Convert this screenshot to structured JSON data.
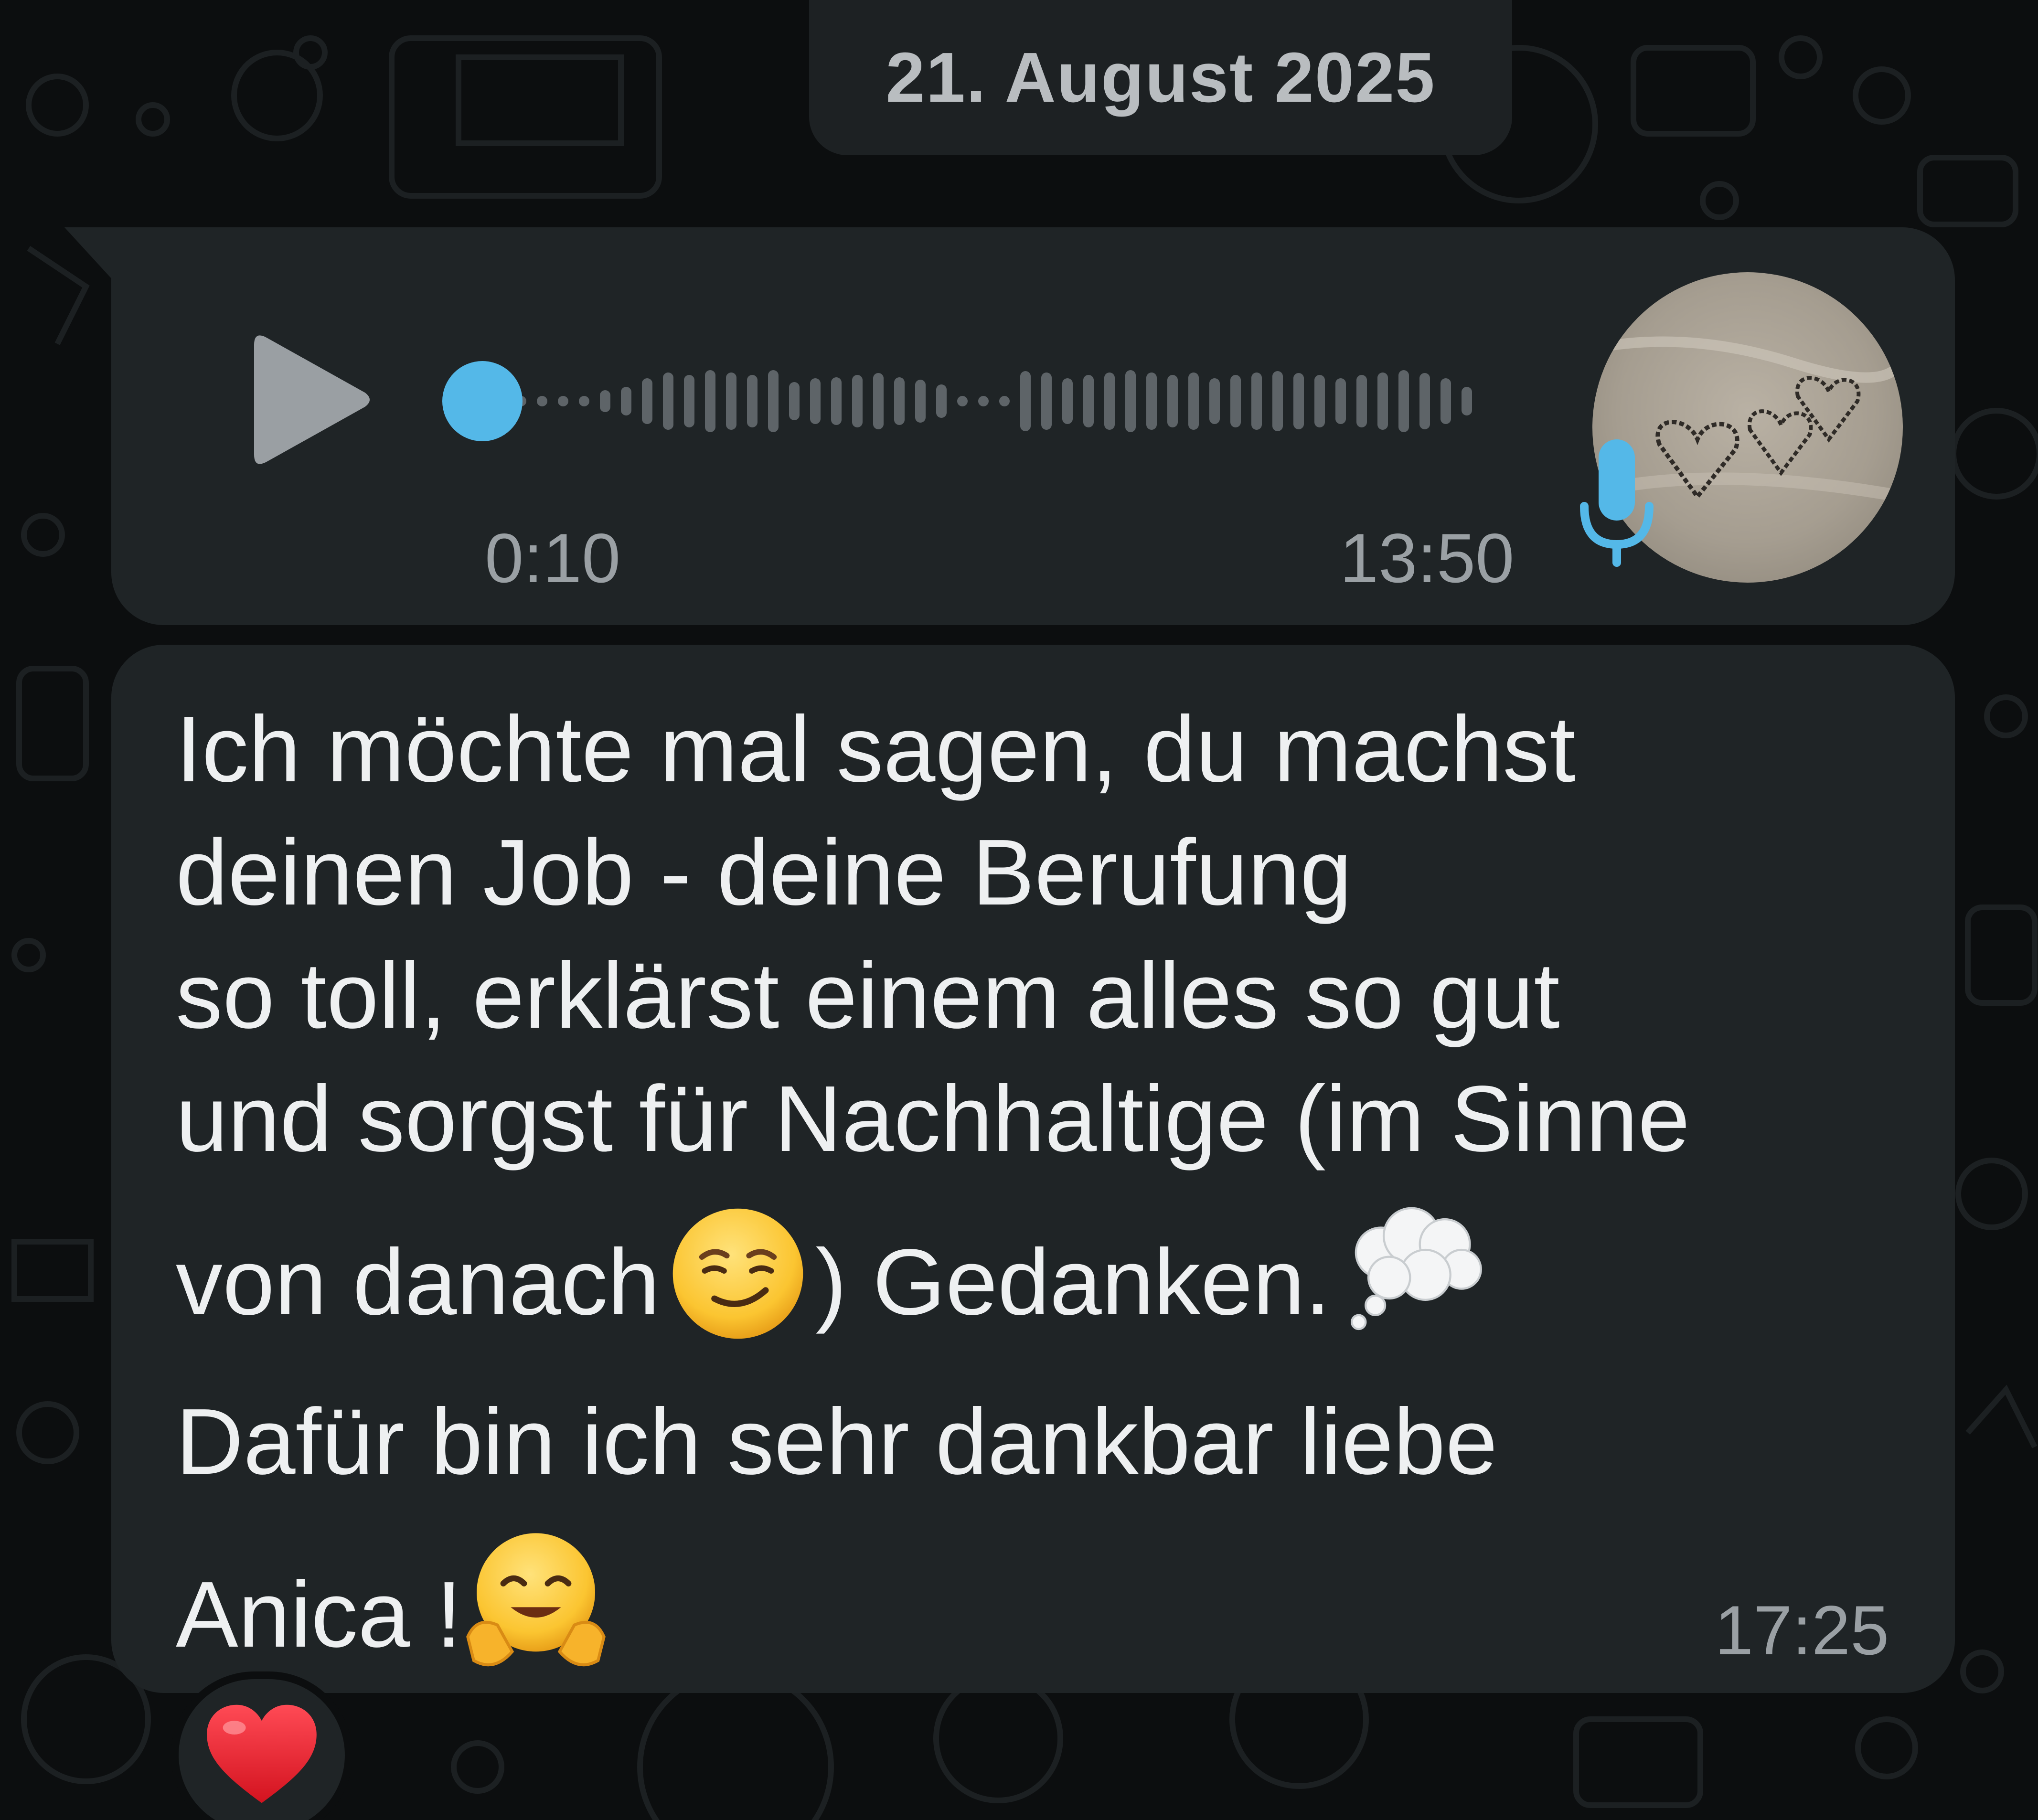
{
  "date_separator": "21. August 2025",
  "voice_message": {
    "duration": "0:10",
    "time": "13:50",
    "progress": 0,
    "play_icon": "play-icon",
    "mic_icon": "microphone-icon",
    "accent_color": "#54b8e8"
  },
  "text_message": {
    "lines": [
      "Ich möchte mal sagen, du machst",
      "deinen Job - deine Berufung",
      "so toll, erklärst einem alles so gut",
      "und sorgst für Nachhaltige (im Sinne"
    ],
    "line5_a": "von danach",
    "line5_b": ")  Gedanken.",
    "line6": "Dafür bin ich sehr dankbar liebe",
    "line7": "Anica !",
    "time": "17:25",
    "emojis": [
      "smirking-face",
      "thought-balloon",
      "hugging-face"
    ]
  },
  "reaction": {
    "emoji": "red-heart"
  },
  "colors": {
    "bubble": "#1f2426",
    "background": "#0c0e0f",
    "text": "#eef0f1",
    "meta": "#9aa0a4"
  }
}
